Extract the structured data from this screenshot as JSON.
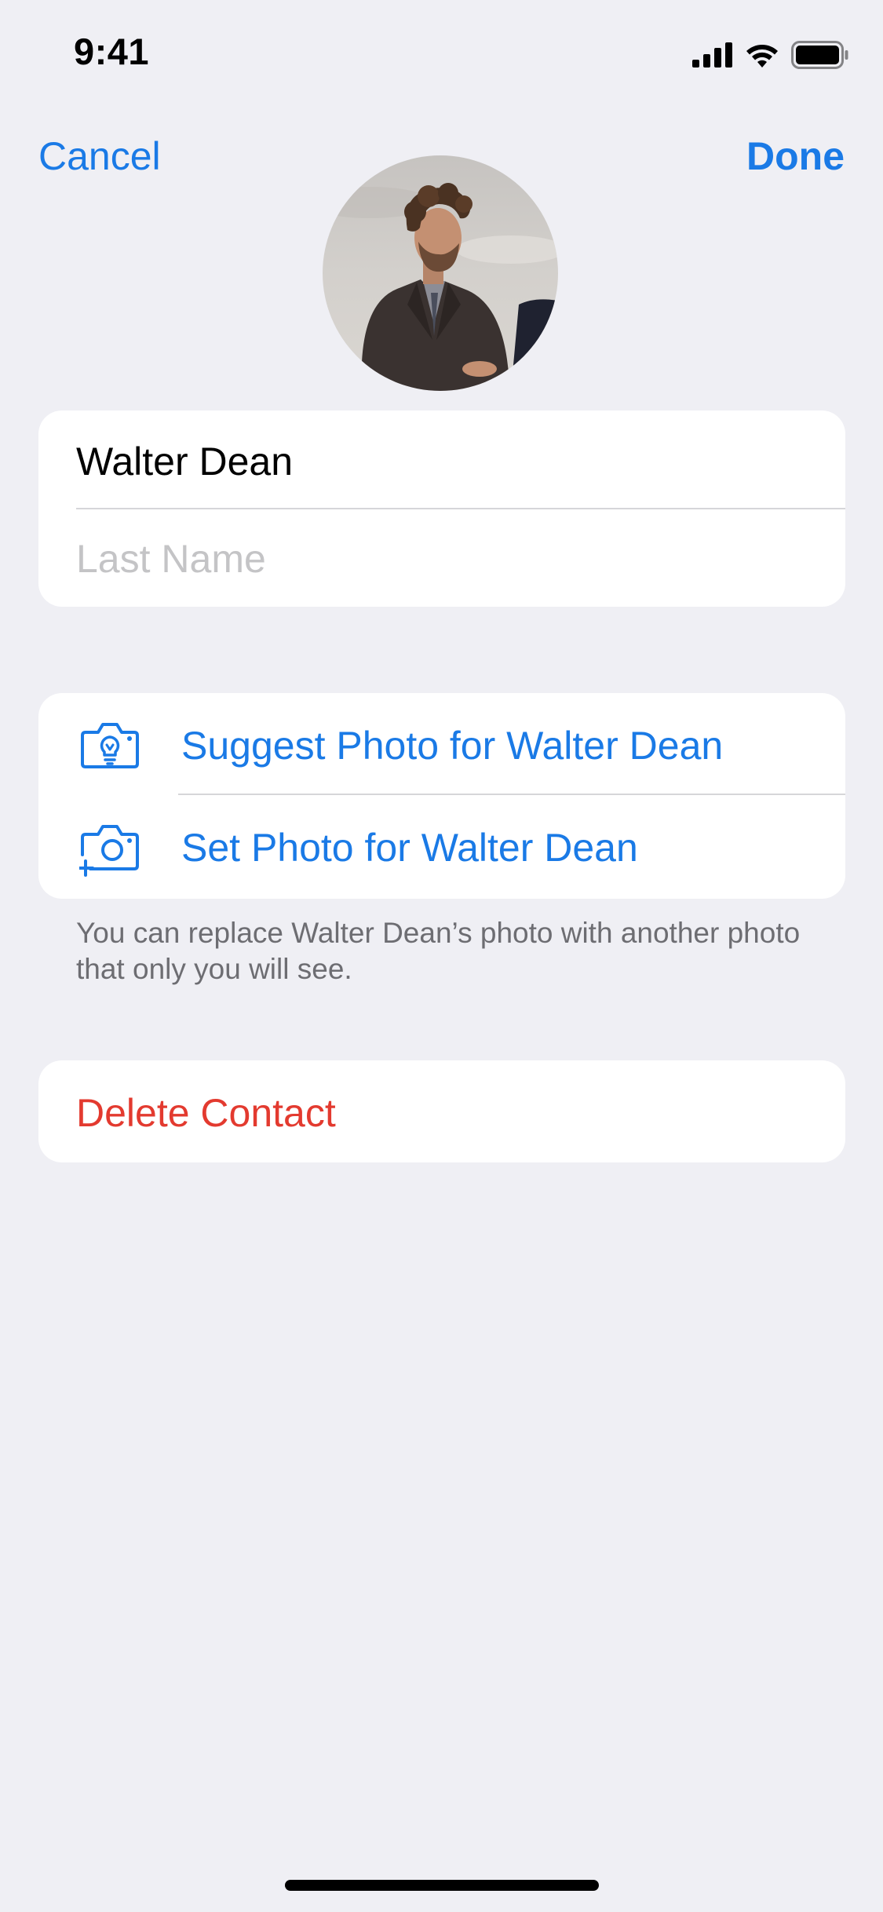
{
  "status_bar": {
    "time": "9:41",
    "icons": [
      "cellular-signal-icon",
      "wifi-icon",
      "battery-icon"
    ]
  },
  "nav": {
    "cancel_label": "Cancel",
    "done_label": "Done"
  },
  "contact": {
    "first_name_value": "Walter Dean",
    "last_name_placeholder": "Last Name"
  },
  "photo_actions": [
    {
      "icon": "camera-lightbulb-icon",
      "label": "Suggest Photo for Walter Dean"
    },
    {
      "icon": "camera-plus-icon",
      "label": "Set Photo for Walter Dean"
    }
  ],
  "footnote": "You can replace Walter Dean’s photo with another photo that only you will see.",
  "delete_label": "Delete Contact",
  "colors": {
    "accent": "#1A7AE6",
    "destructive": "#E33A2F",
    "background": "#EFEFF4",
    "card": "#FFFFFF",
    "secondary_text": "#6D6D72",
    "placeholder": "#C4C4C6"
  }
}
